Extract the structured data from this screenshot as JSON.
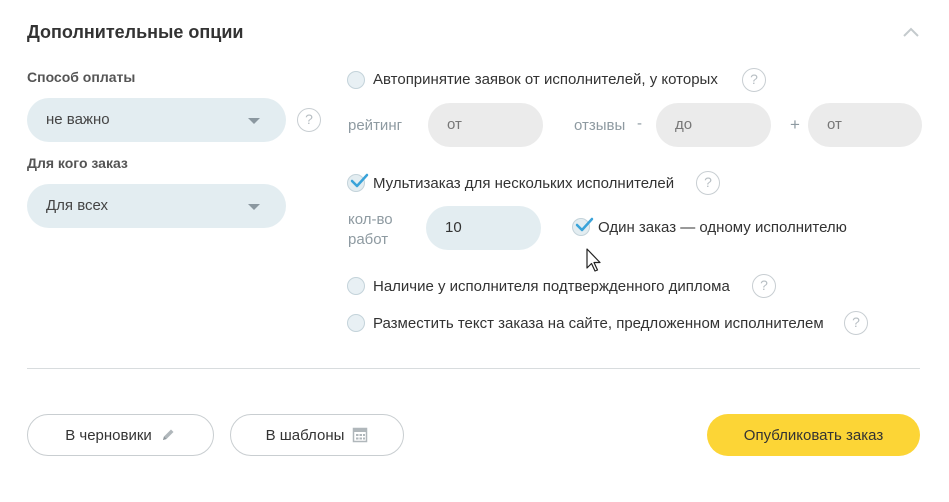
{
  "section": {
    "title": "Дополнительные опции"
  },
  "payment": {
    "label": "Способ оплаты",
    "value": "не важно"
  },
  "audience": {
    "label": "Для кого заказ",
    "value": "Для всех"
  },
  "autoaccept": {
    "label": "Автопринятие заявок от исполнителей, у которых",
    "checked": false,
    "rating_label": "рейтинг",
    "rating_placeholder": "от",
    "reviews_label": "отзывы",
    "minus": "-",
    "reviews_minus_placeholder": "до",
    "plus": "+",
    "reviews_plus_placeholder": "от"
  },
  "multiorder": {
    "label": "Мультизаказ для нескольких исполнителей",
    "checked": true,
    "count_label_line1": "кол-во",
    "count_label_line2": "работ",
    "count_value": "10",
    "one_per_label": "Один заказ — одному исполнителю",
    "one_per_checked": true
  },
  "diploma": {
    "label": "Наличие у исполнителя подтвержденного диплома",
    "checked": false
  },
  "publish_text": {
    "label": "Разместить текст заказа на сайте, предложенном исполнителем",
    "checked": false
  },
  "help_glyph": "?",
  "buttons": {
    "drafts": "В черновики",
    "templates": "В шаблоны",
    "publish": "Опубликовать заказ"
  },
  "colors": {
    "accent_yellow": "#fcd536",
    "field_blue": "#e3edf1",
    "check_blue": "#3aa3d9"
  }
}
